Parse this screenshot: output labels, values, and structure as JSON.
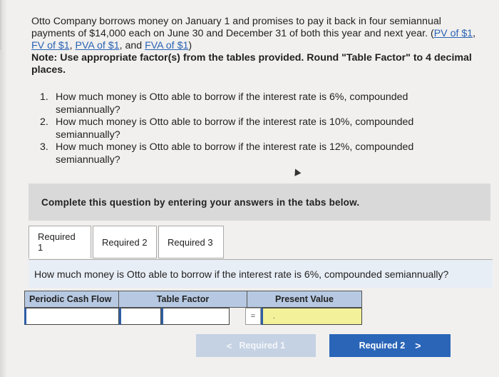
{
  "question": {
    "text_before": "Otto Company borrows money on January 1 and promises to pay it back in four semiannual payments of $14,000 each on June 30 and December 31 of both this year and next year. (",
    "links": [
      "PV of $1",
      "FV of $1",
      "PVA of $1",
      "FVA of $1"
    ],
    "sep1": ", ",
    "sep2": ", ",
    "sep3": ", and ",
    "close": ")",
    "note": "Note: Use appropriate factor(s) from the tables provided. Round \"Table Factor\" to 4 decimal places."
  },
  "items": [
    {
      "num": "1.",
      "text": "How much money is Otto able to borrow if the interest rate is 6%, compounded semiannually?"
    },
    {
      "num": "2.",
      "text": "How much money is Otto able to borrow if the interest rate is 10%, compounded semiannually?"
    },
    {
      "num": "3.",
      "text": "How much money is Otto able to borrow if the interest rate is 12%, compounded semiannually?"
    }
  ],
  "banner": "Complete this question by entering your answers in the tabs below.",
  "tabs": [
    "Required 1",
    "Required 2",
    "Required 3"
  ],
  "prompt": "How much money is Otto able to borrow if the interest rate is 6%, compounded semiannually?",
  "table": {
    "headers": [
      "Periodic Cash Flow",
      "Table Factor",
      "Present Value"
    ],
    "equals": "=",
    "pv_value": "."
  },
  "nav": {
    "prev": "Required 1",
    "next": "Required 2",
    "prev_icon": "chevron-left-icon",
    "next_icon": "chevron-right-icon"
  },
  "colors": {
    "link": "#2a63b5",
    "header_bg": "#b7c9e2",
    "pv_bg": "#f3f29a",
    "next_btn": "#2a65b8",
    "prev_btn": "#c5d2e4"
  }
}
